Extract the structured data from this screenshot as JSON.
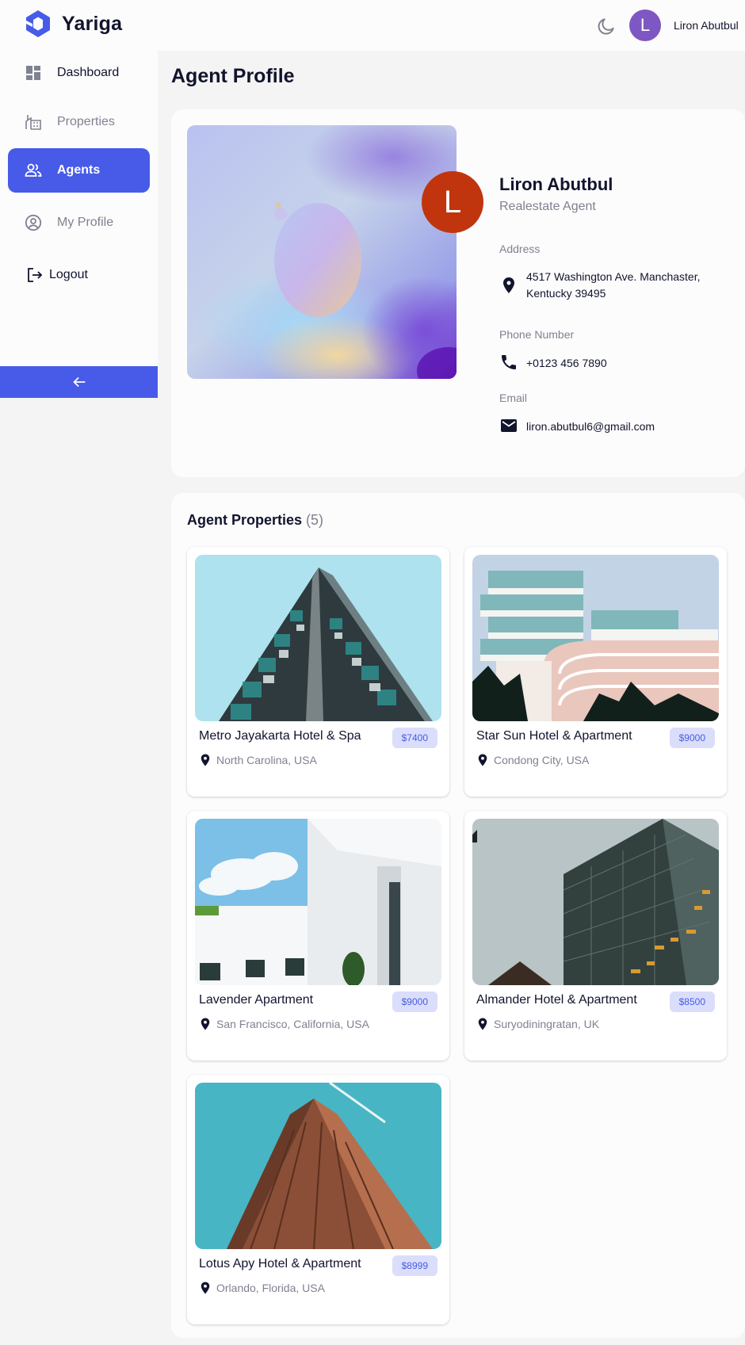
{
  "header": {
    "brand": "Yariga",
    "user_initial": "L",
    "user_name": "Liron Abutbul"
  },
  "sidebar": {
    "items": [
      {
        "label": "Dashboard",
        "icon": "dashboard-icon"
      },
      {
        "label": "Properties",
        "icon": "properties-icon"
      },
      {
        "label": "Agents",
        "icon": "agents-icon",
        "active": true
      },
      {
        "label": "My Profile",
        "icon": "profile-icon"
      },
      {
        "label": "Logout",
        "icon": "logout-icon"
      }
    ],
    "collapse_icon": "arrow-left-icon"
  },
  "page": {
    "title": "Agent Profile"
  },
  "profile": {
    "initial": "L",
    "name": "Liron Abutbul",
    "role": "Realestate Agent",
    "address_label": "Address",
    "address_line1": "4517 Washington Ave. Manchaster,",
    "address_line2": "Kentucky 39495",
    "phone_label": "Phone Number",
    "phone": "+0123 456 7890",
    "email_label": "Email",
    "email": "liron.abutbul6@gmail.com"
  },
  "properties": {
    "title": "Agent Properties",
    "count": "(5)",
    "items": [
      {
        "name": "Metro Jayakarta Hotel & Spa",
        "price": "$7400",
        "location": "North Carolina, USA"
      },
      {
        "name": "Star Sun Hotel & Apartment",
        "price": "$9000",
        "location": "Condong City, USA"
      },
      {
        "name": "Lavender Apartment",
        "price": "$9000",
        "location": "San Francisco, California, USA"
      },
      {
        "name": "Almander Hotel & Apartment",
        "price": "$8500",
        "location": "Suryodiningratan, UK"
      },
      {
        "name": "Lotus Apy Hotel & Apartment",
        "price": "$8999",
        "location": "Orlando, Florida, USA"
      }
    ]
  },
  "colors": {
    "accent": "#475be8",
    "text": "#11142d",
    "muted": "#808191",
    "price_bg": "#dadefa"
  }
}
